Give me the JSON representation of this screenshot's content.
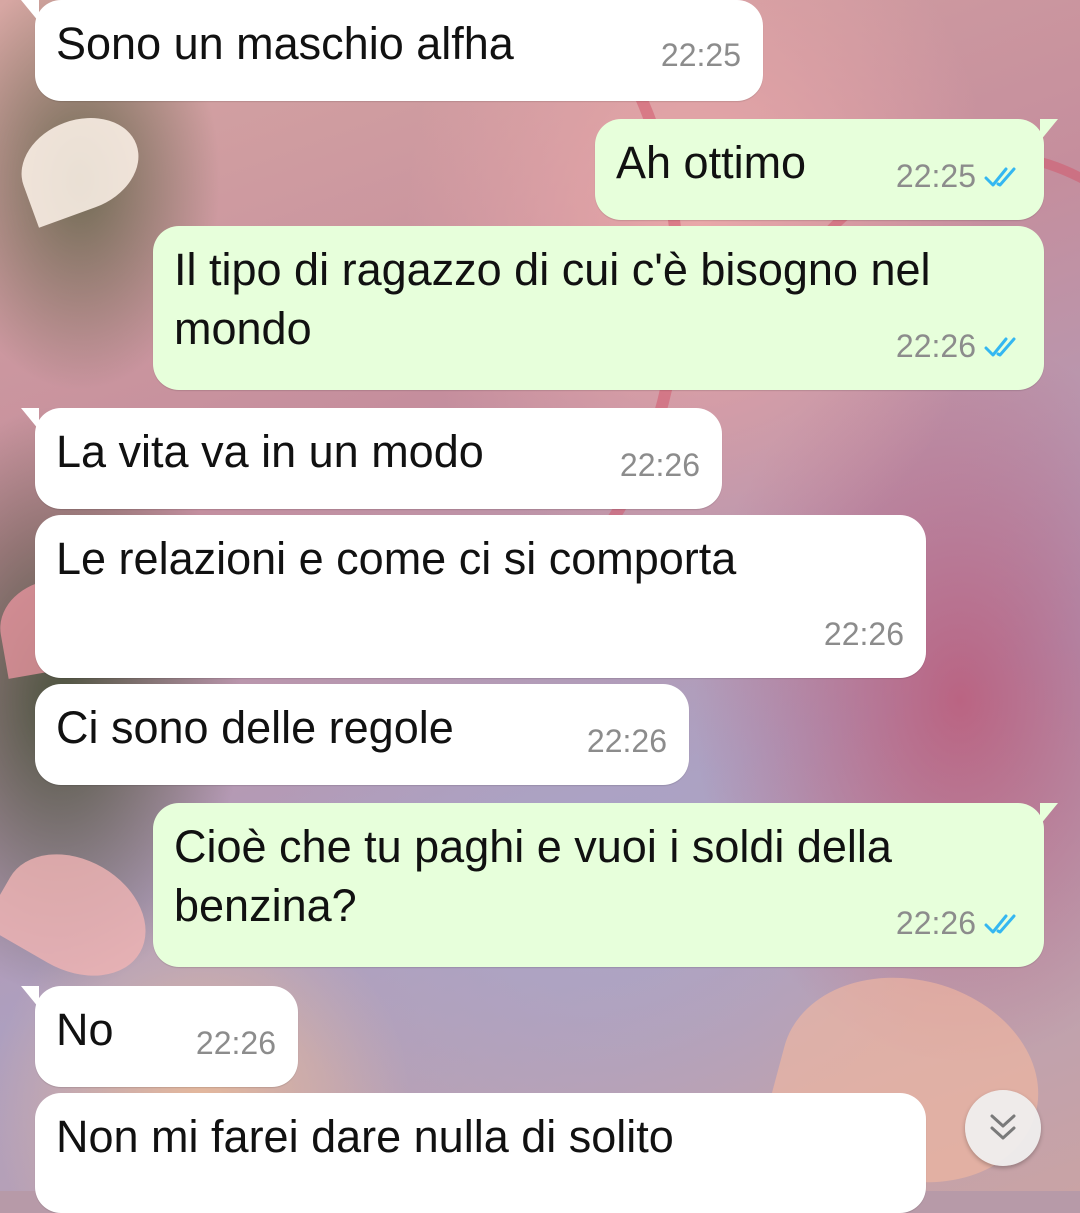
{
  "messages": [
    {
      "direction": "in",
      "text": "Sono un maschio alfha",
      "time": "22:25"
    },
    {
      "direction": "out",
      "text": "Ah ottimo",
      "time": "22:25",
      "status": "read"
    },
    {
      "direction": "out",
      "text": "Il tipo di ragazzo di cui c'è bisogno nel mondo",
      "time": "22:26",
      "status": "read"
    },
    {
      "direction": "in",
      "text": "La vita va in un modo",
      "time": "22:26"
    },
    {
      "direction": "in",
      "text": "Le relazioni e come ci si comporta",
      "time": "22:26"
    },
    {
      "direction": "in",
      "text": "Ci sono delle regole",
      "time": "22:26"
    },
    {
      "direction": "out",
      "text": "Cioè che tu paghi e vuoi i soldi della benzina?",
      "time": "22:26",
      "status": "read"
    },
    {
      "direction": "in",
      "text": "No",
      "time": "22:26"
    },
    {
      "direction": "in",
      "text": "Non mi farei dare nulla di solito",
      "time": ""
    }
  ],
  "icons": {
    "read_receipt": "double-check-icon",
    "scroll_down": "double-chevron-down-icon"
  },
  "colors": {
    "incoming_bubble": "#ffffff",
    "outgoing_bubble": "#e7ffdb",
    "timestamp": "#8c8c8c",
    "read_tick": "#34b7f1"
  }
}
